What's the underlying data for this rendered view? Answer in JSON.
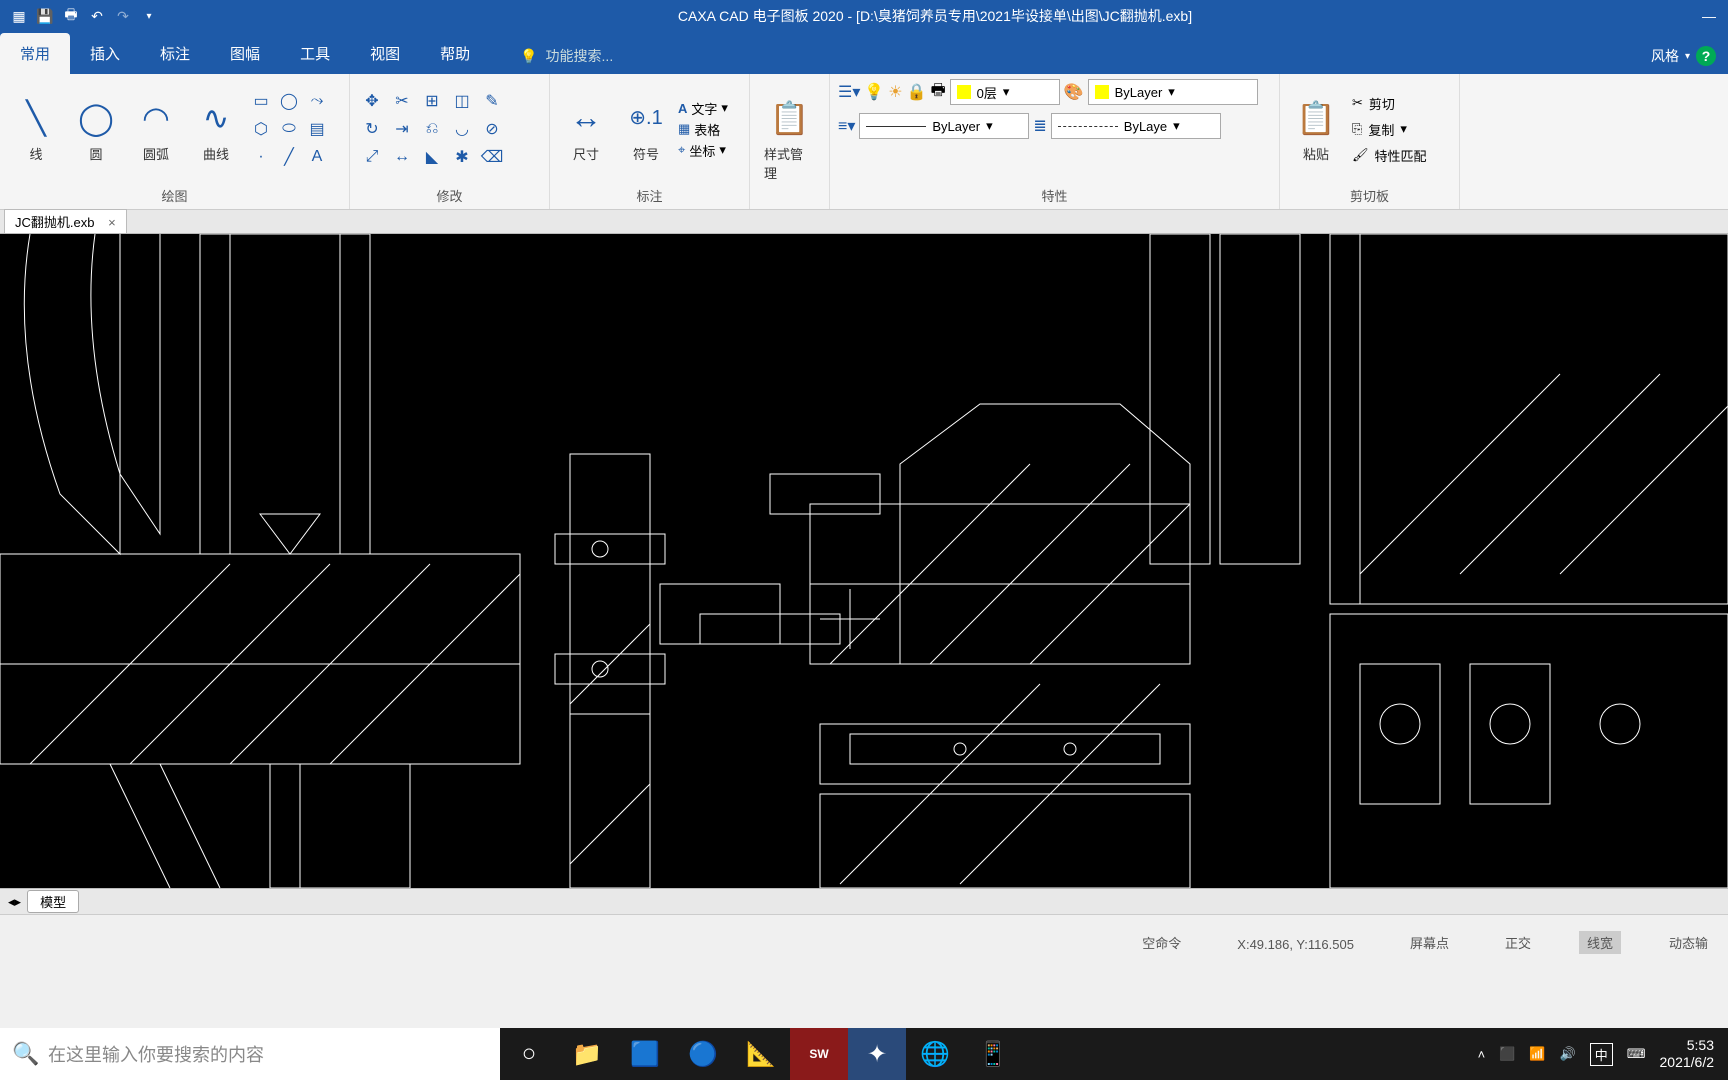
{
  "titlebar": {
    "title": "CAXA CAD 电子图板 2020 - [D:\\臭猪饲养员专用\\2021毕设接单\\出图\\JC翻抛机.exb]"
  },
  "tabs": {
    "items": [
      "常用",
      "插入",
      "标注",
      "图幅",
      "工具",
      "视图",
      "帮助"
    ],
    "active": 0,
    "search_placeholder": "功能搜索...",
    "style_label": "风格"
  },
  "ribbon": {
    "draw": {
      "label": "绘图",
      "line": "线",
      "circle": "圆",
      "arc": "圆弧",
      "curve": "曲线"
    },
    "modify": {
      "label": "修改"
    },
    "dim": {
      "label": "标注",
      "dim": "尺寸",
      "sym": "符号",
      "text": "文字",
      "table": "表格",
      "coord": "坐标"
    },
    "style": {
      "label": "",
      "mgr": "样式管理"
    },
    "props": {
      "label": "特性",
      "layer": "0层",
      "bylayer1": "ByLayer",
      "bylayer2": "ByLayer",
      "bylayer3": "ByLaye"
    },
    "clip": {
      "label": "剪切板",
      "paste": "粘贴",
      "cut": "剪切",
      "copy": "复制",
      "match": "特性匹配"
    }
  },
  "doctab": {
    "name": "JC翻抛机.exb"
  },
  "bottom_tab": "模型",
  "status": {
    "cmd": "空命令",
    "coords": "X:49.186, Y:116.505",
    "screen": "屏幕点",
    "ortho": "正交",
    "lw": "线宽",
    "dyn": "动态输"
  },
  "taskbar": {
    "search_placeholder": "在这里输入你要搜索的内容",
    "ime": "中",
    "time": "5:53",
    "date": "2021/6/2"
  }
}
